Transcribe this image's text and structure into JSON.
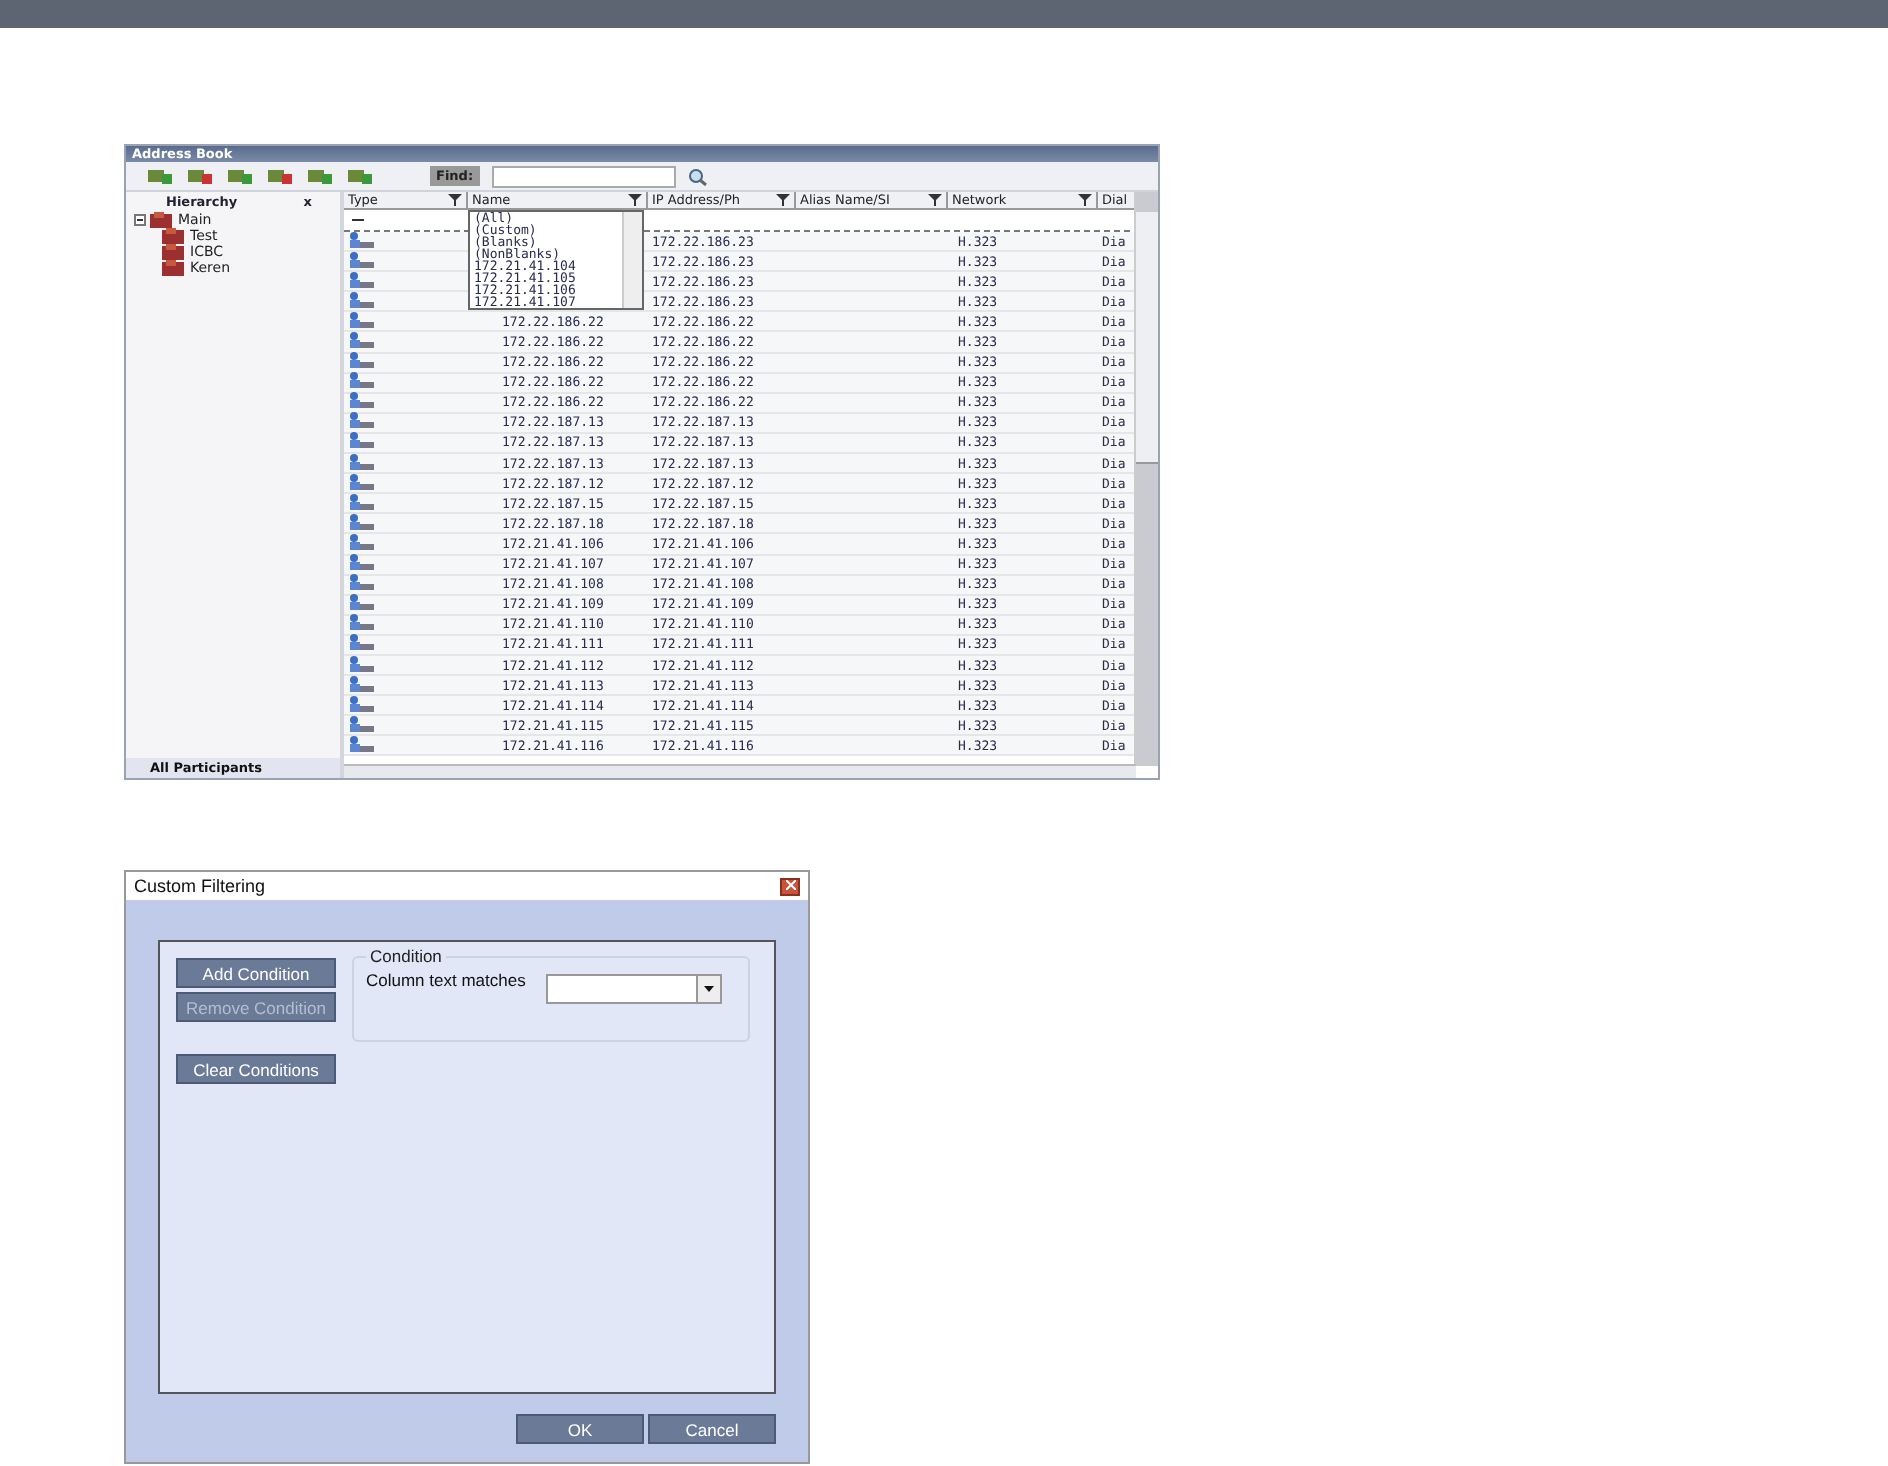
{
  "address_book": {
    "title": "Address Book",
    "find_label": "Find:",
    "hierarchy": {
      "title": "Hierarchy",
      "close": "x",
      "tree": [
        {
          "label": "Main",
          "expanded": true,
          "children": [
            {
              "label": "Test"
            },
            {
              "label": "ICBC"
            },
            {
              "label": "Keren"
            }
          ]
        }
      ],
      "footer": "All Participants"
    },
    "columns": [
      "Type",
      "Name",
      "IP Address/Ph",
      "Alias Name/SI",
      "Network",
      "Dial"
    ],
    "filter_dropdown": {
      "items": [
        "(All)",
        "(Custom)",
        "(Blanks)",
        "(NonBlanks)",
        "172.21.41.104",
        "172.21.41.105",
        "172.21.41.106",
        "172.21.41.107"
      ]
    },
    "rows": [
      {
        "ip": "172.22.186.23",
        "network": "H.323",
        "dial": "Dia"
      },
      {
        "ip": "172.22.186.23",
        "network": "H.323",
        "dial": "Dia"
      },
      {
        "ip": "172.22.186.23",
        "network": "H.323",
        "dial": "Dia"
      },
      {
        "ip": "172.22.186.23",
        "network": "H.323",
        "dial": "Dia"
      },
      {
        "name": "172.22.186.22",
        "ip": "172.22.186.22",
        "network": "H.323",
        "dial": "Dia"
      },
      {
        "name": "172.22.186.22",
        "ip": "172.22.186.22",
        "network": "H.323",
        "dial": "Dia"
      },
      {
        "name": "172.22.186.22",
        "ip": "172.22.186.22",
        "network": "H.323",
        "dial": "Dia"
      },
      {
        "name": "172.22.186.22",
        "ip": "172.22.186.22",
        "network": "H.323",
        "dial": "Dia"
      },
      {
        "name": "172.22.186.22",
        "ip": "172.22.186.22",
        "network": "H.323",
        "dial": "Dia"
      },
      {
        "name": "172.22.187.13",
        "ip": "172.22.187.13",
        "network": "H.323",
        "dial": "Dia"
      },
      {
        "name": "172.22.187.13",
        "ip": "172.22.187.13",
        "network": "H.323",
        "dial": "Dia"
      },
      {
        "name": "172.22.187.13",
        "ip": "172.22.187.13",
        "network": "H.323",
        "dial": "Dia"
      },
      {
        "name": "172.22.187.12",
        "ip": "172.22.187.12",
        "network": "H.323",
        "dial": "Dia"
      },
      {
        "name": "172.22.187.15",
        "ip": "172.22.187.15",
        "network": "H.323",
        "dial": "Dia"
      },
      {
        "name": "172.22.187.18",
        "ip": "172.22.187.18",
        "network": "H.323",
        "dial": "Dia"
      },
      {
        "name": "172.21.41.106",
        "ip": "172.21.41.106",
        "network": "H.323",
        "dial": "Dia"
      },
      {
        "name": "172.21.41.107",
        "ip": "172.21.41.107",
        "network": "H.323",
        "dial": "Dia"
      },
      {
        "name": "172.21.41.108",
        "ip": "172.21.41.108",
        "network": "H.323",
        "dial": "Dia"
      },
      {
        "name": "172.21.41.109",
        "ip": "172.21.41.109",
        "network": "H.323",
        "dial": "Dia"
      },
      {
        "name": "172.21.41.110",
        "ip": "172.21.41.110",
        "network": "H.323",
        "dial": "Dia"
      },
      {
        "name": "172.21.41.111",
        "ip": "172.21.41.111",
        "network": "H.323",
        "dial": "Dia"
      },
      {
        "name": "172.21.41.112",
        "ip": "172.21.41.112",
        "network": "H.323",
        "dial": "Dia"
      },
      {
        "name": "172.21.41.113",
        "ip": "172.21.41.113",
        "network": "H.323",
        "dial": "Dia"
      },
      {
        "name": "172.21.41.114",
        "ip": "172.21.41.114",
        "network": "H.323",
        "dial": "Dia"
      },
      {
        "name": "172.21.41.115",
        "ip": "172.21.41.115",
        "network": "H.323",
        "dial": "Dia"
      },
      {
        "name": "172.21.41.116",
        "ip": "172.21.41.116",
        "network": "H.323",
        "dial": "Dia"
      }
    ]
  },
  "custom_filtering": {
    "title": "Custom Filtering",
    "side_buttons": [
      {
        "label": "Add Condition",
        "disabled": false
      },
      {
        "label": "Remove Condition",
        "disabled": true
      },
      {
        "label": "Clear Conditions",
        "disabled": false
      }
    ],
    "condition": {
      "legend": "Condition",
      "label": "Column text matches"
    },
    "buttons": [
      "OK",
      "Cancel"
    ]
  }
}
